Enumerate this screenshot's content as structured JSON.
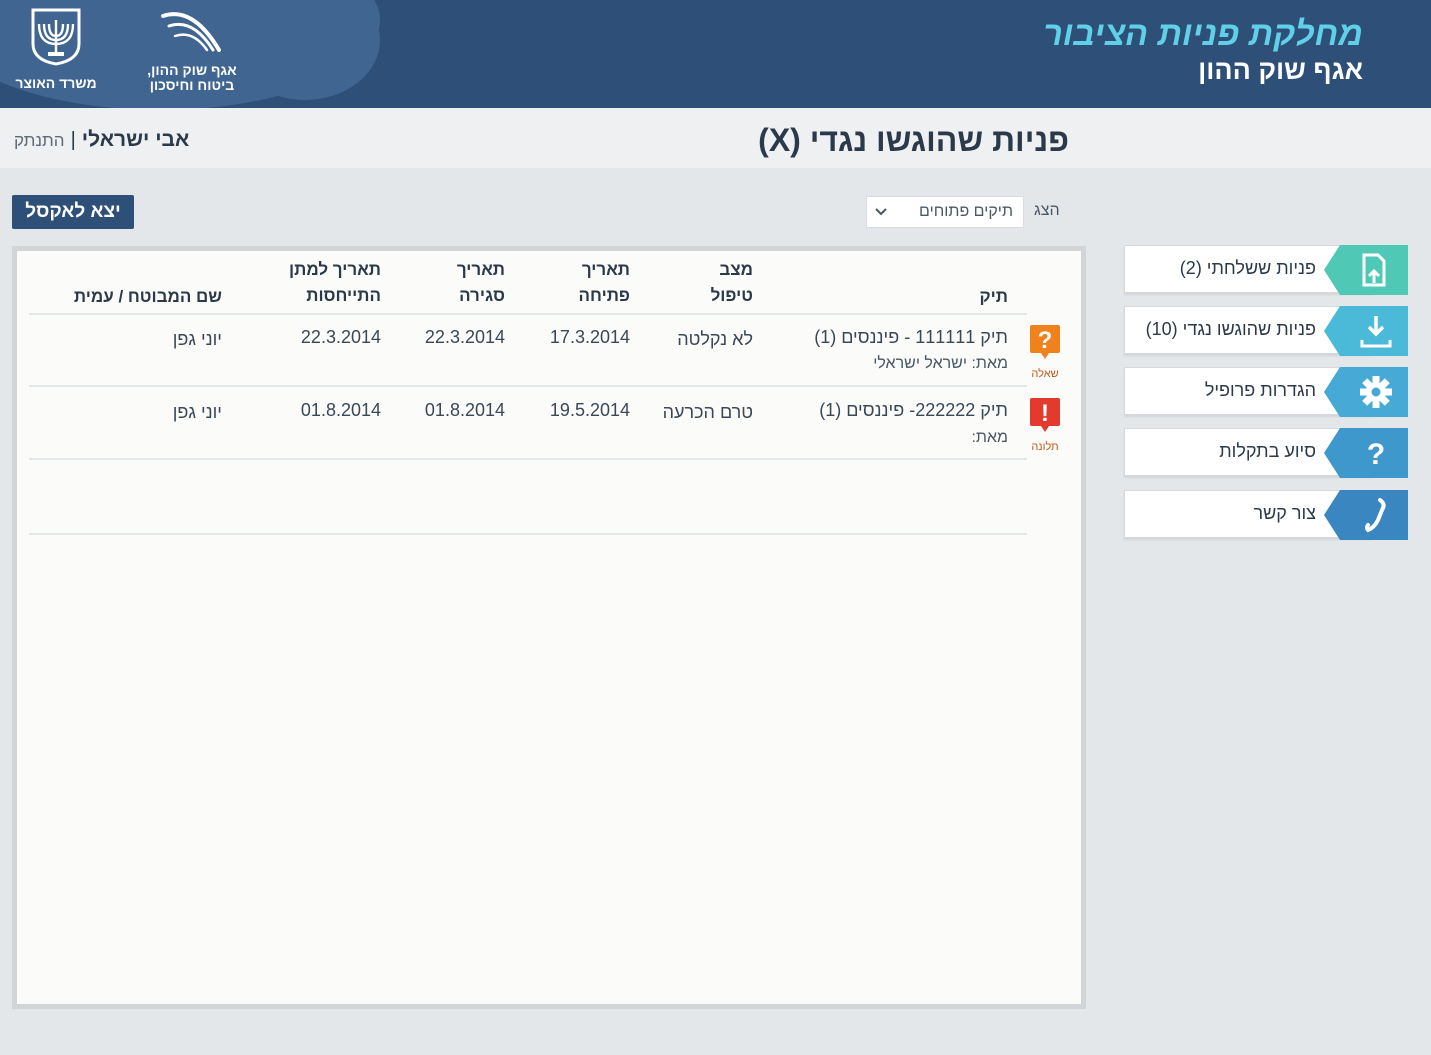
{
  "header": {
    "emblem_caption": "משרד האוצר",
    "agaf_caption_1": "אגף שוק ההון,",
    "agaf_caption_2": "ביטוח וחיסכון",
    "brand_title": "מחלקת פניות הציבור",
    "brand_subtitle": "אגף שוק ההון"
  },
  "page": {
    "title": "פניות שהוגשו נגדי (X)"
  },
  "user": {
    "name": "אבי ישראלי",
    "separator": "|",
    "logout_label": "התנתק"
  },
  "toolbar": {
    "export_label": "יצא לאקסל",
    "show_label": "הצג",
    "filter_value": "תיקים פתוחים"
  },
  "table": {
    "headers": {
      "file": "תיק",
      "status_1": "מצב",
      "status_2": "טיפול",
      "opened_1": "תאריך",
      "opened_2": "פתיחה",
      "closed_1": "תאריך",
      "closed_2": "סגירה",
      "respond_1": "תאריך למתן",
      "respond_2": "התייחסות",
      "respondent": "שם המבוטח / עמית"
    },
    "rows": [
      {
        "type_label": "שאלה",
        "file": "תיק 111111 - פיננסים (1)",
        "from": "מאת: ישראל ישראלי",
        "status": "לא נקלטה",
        "opened": "17.3.2014",
        "closed": "22.3.2014",
        "respond_by": "22.3.2014",
        "respondent": "יוני גפן"
      },
      {
        "type_label": "תלונה",
        "file": "תיק 222222- פיננסים (1)",
        "from": "מאת:",
        "status": "טרם הכרעה",
        "opened": "19.5.2014",
        "closed": "01.8.2014",
        "respond_by": "01.8.2014",
        "respondent": "יוני גפן"
      }
    ]
  },
  "nav": {
    "items": [
      {
        "label": "פניות ששלחתי (2)",
        "icon": "file-upload-icon",
        "color": "#4fc8b5"
      },
      {
        "label": "פניות שהוגשו נגדי (10)",
        "icon": "download-icon",
        "color": "#4bbad9"
      },
      {
        "label": "הגדרות פרופיל",
        "icon": "gear-icon",
        "color": "#46a9d6"
      },
      {
        "label": "סיוע בתקלות",
        "icon": "question-icon",
        "color": "#3e98cc"
      },
      {
        "label": "צור קשר",
        "icon": "phone-icon",
        "color": "#3a86c0"
      }
    ]
  },
  "colors": {
    "header_bg": "#2d4f78",
    "brand_accent": "#5fd0e8",
    "question_badge": "#f0821e",
    "complaint_badge": "#e23b2e"
  }
}
